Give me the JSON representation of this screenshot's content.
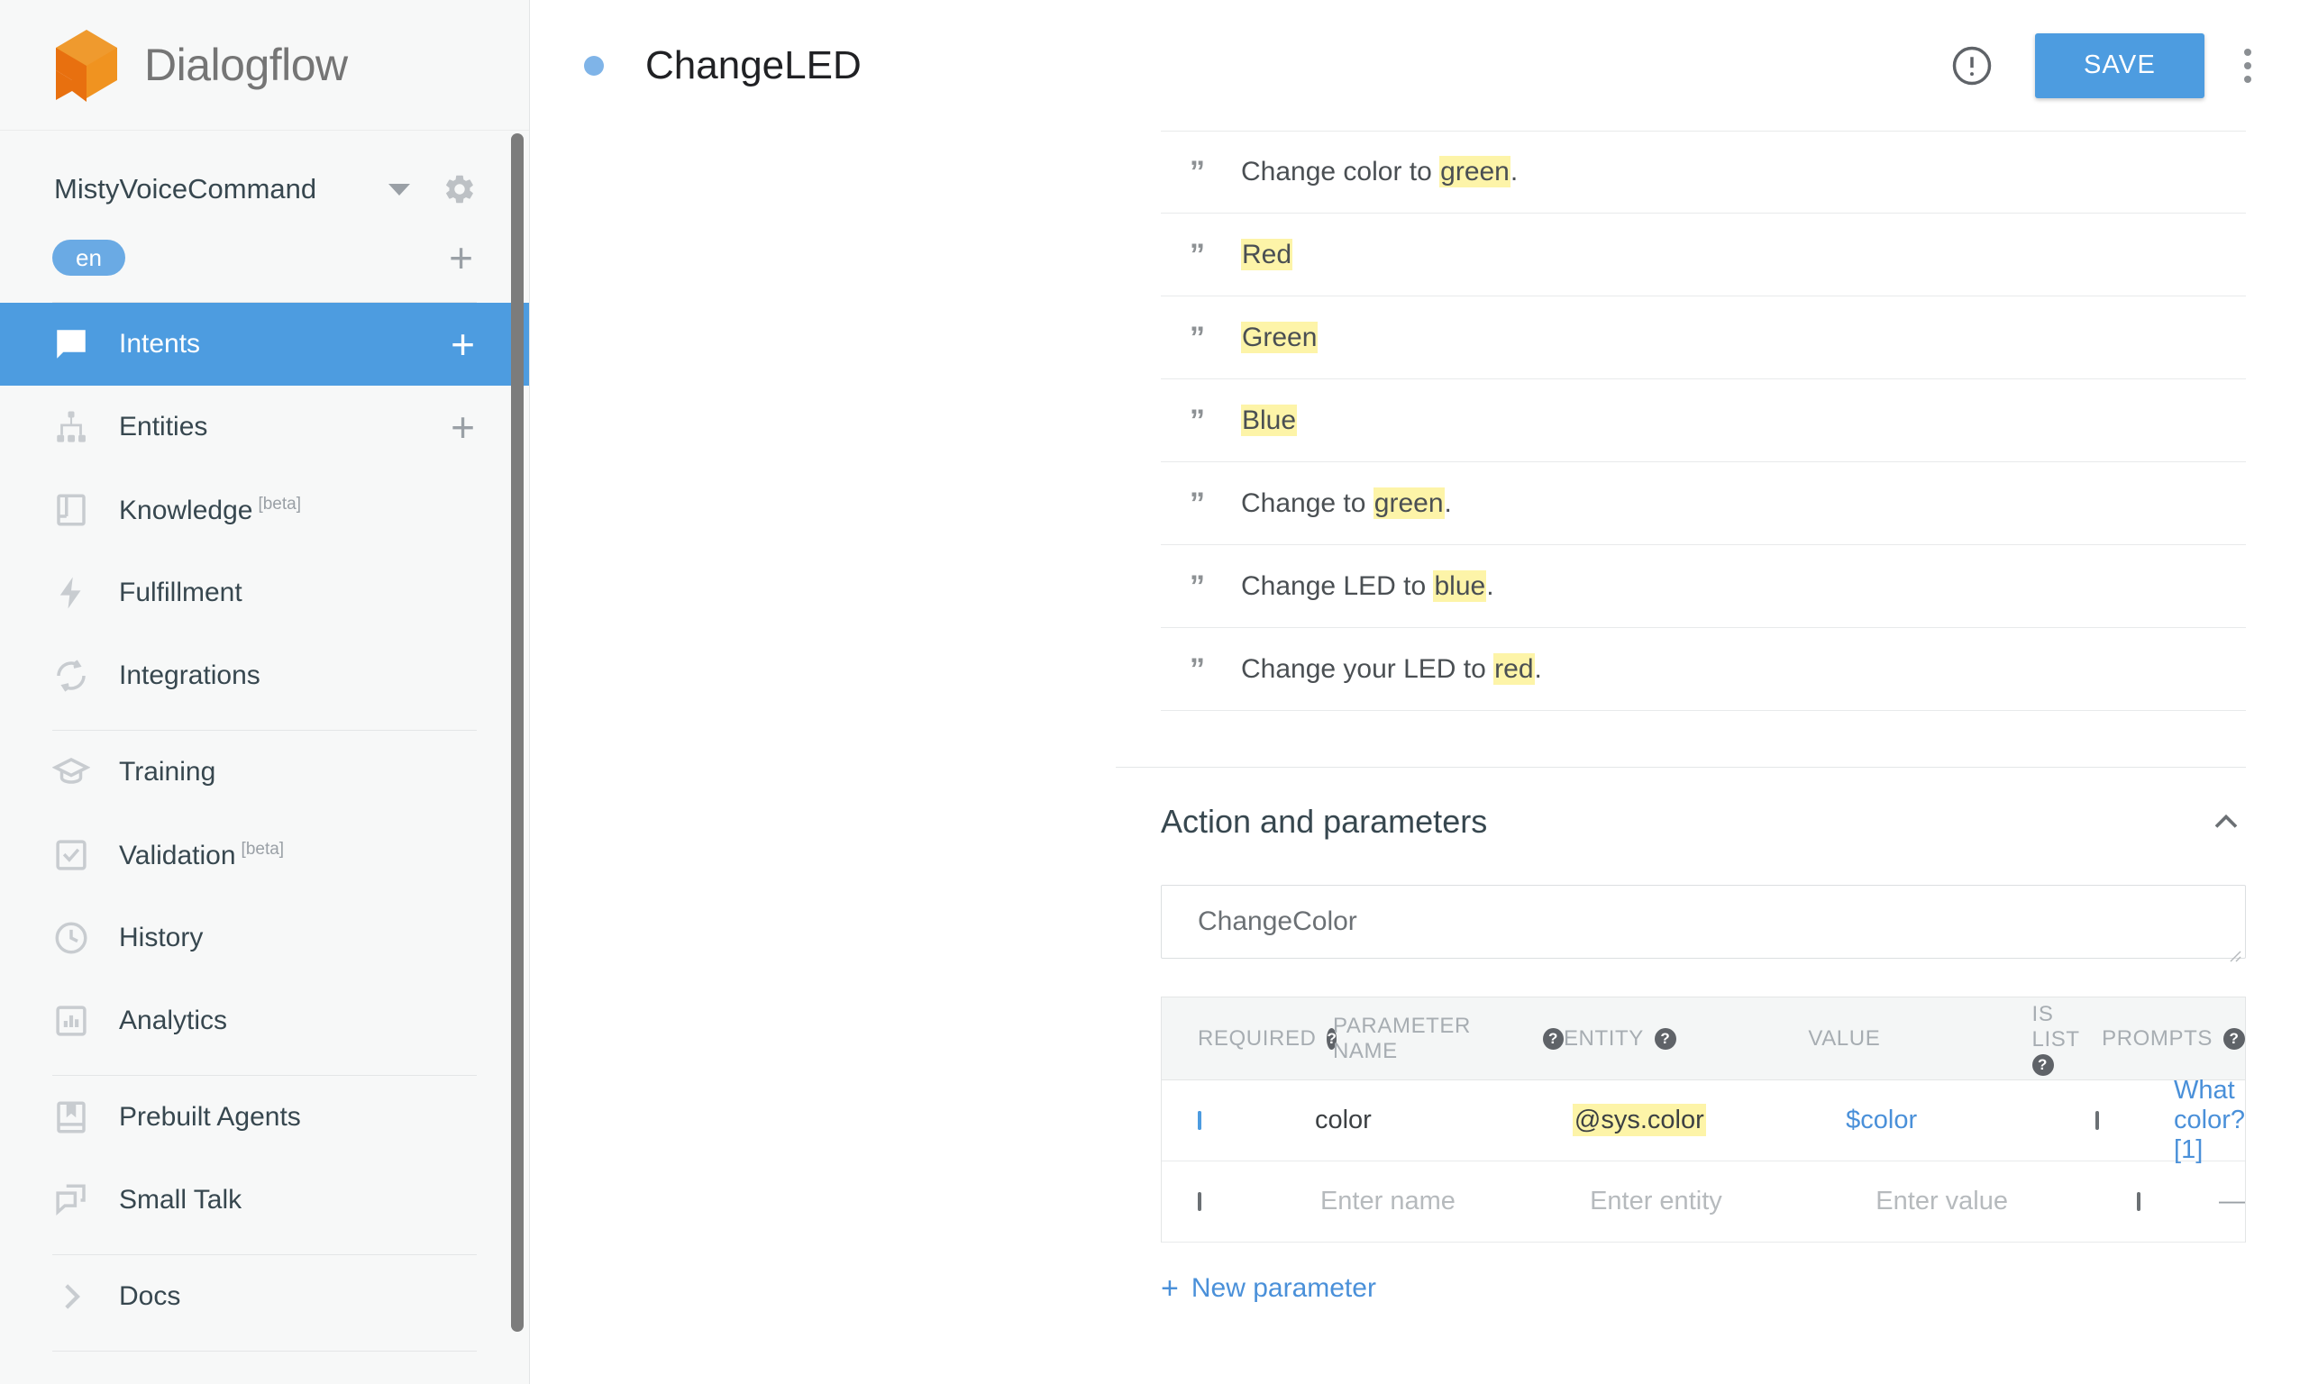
{
  "brand": {
    "name": "Dialogflow",
    "logo_icon": "dialogflow-cube-logo"
  },
  "sidebar": {
    "agent": {
      "name": "MistyVoiceCommand",
      "dropdown_icon": "chevron-down-icon",
      "settings_icon": "gear-icon"
    },
    "language": {
      "chip": "en",
      "add_icon": "plus-icon"
    },
    "items": [
      {
        "label": "Intents",
        "icon": "chat-bubble-icon",
        "active": true,
        "has_add": true,
        "beta": ""
      },
      {
        "label": "Entities",
        "icon": "hierarchy-icon",
        "active": false,
        "has_add": true,
        "beta": ""
      },
      {
        "label": "Knowledge",
        "icon": "book-icon",
        "active": false,
        "has_add": false,
        "beta": "[beta]"
      },
      {
        "label": "Fulfillment",
        "icon": "lightning-bolt-icon",
        "active": false,
        "has_add": false,
        "beta": ""
      },
      {
        "label": "Integrations",
        "icon": "sync-arrows-icon",
        "active": false,
        "has_add": false,
        "beta": ""
      },
      {
        "label": "Training",
        "icon": "graduation-cap-icon",
        "active": false,
        "has_add": false,
        "beta": ""
      },
      {
        "label": "Validation",
        "icon": "checkbox-square-icon",
        "active": false,
        "has_add": false,
        "beta": "[beta]"
      },
      {
        "label": "History",
        "icon": "clock-icon",
        "active": false,
        "has_add": false,
        "beta": ""
      },
      {
        "label": "Analytics",
        "icon": "bar-chart-icon",
        "active": false,
        "has_add": false,
        "beta": ""
      },
      {
        "label": "Prebuilt Agents",
        "icon": "bookmark-book-icon",
        "active": false,
        "has_add": false,
        "beta": ""
      },
      {
        "label": "Small Talk",
        "icon": "double-chat-icon",
        "active": false,
        "has_add": false,
        "beta": ""
      },
      {
        "label": "Docs",
        "icon": "chevron-right-icon",
        "active": false,
        "has_add": false,
        "beta": ""
      }
    ]
  },
  "topbar": {
    "status_dot_color": "#7fb4e8",
    "title": "ChangeLED",
    "warning_icon": "exclamation-circle-icon",
    "save_label": "SAVE",
    "more_icon": "kebab-menu-icon"
  },
  "training_phrases": [
    {
      "prefix": "Change color to ",
      "highlight": "green",
      "suffix": "."
    },
    {
      "prefix": "",
      "highlight": "Red",
      "suffix": ""
    },
    {
      "prefix": "",
      "highlight": "Green",
      "suffix": ""
    },
    {
      "prefix": "",
      "highlight": "Blue",
      "suffix": ""
    },
    {
      "prefix": "Change to ",
      "highlight": "green",
      "suffix": "."
    },
    {
      "prefix": "Change LED to ",
      "highlight": "blue",
      "suffix": "."
    },
    {
      "prefix": "Change your LED to ",
      "highlight": "red",
      "suffix": "."
    }
  ],
  "action_section": {
    "title": "Action and parameters",
    "collapse_icon": "chevron-up-icon",
    "action_value": "ChangeColor",
    "columns": [
      {
        "label": "REQUIRED",
        "help": true
      },
      {
        "label": "PARAMETER NAME",
        "help": true
      },
      {
        "label": "ENTITY",
        "help": true
      },
      {
        "label": "VALUE",
        "help": false
      },
      {
        "label": "IS LIST",
        "help": true
      },
      {
        "label": "PROMPTS",
        "help": true
      }
    ],
    "rows": [
      {
        "required": true,
        "name": "color",
        "name_placeholder": "",
        "entity": "@sys.color",
        "entity_placeholder": "",
        "value": "$color",
        "value_placeholder": "",
        "is_list": false,
        "prompts": "What color? [1]"
      },
      {
        "required": false,
        "name": "",
        "name_placeholder": "Enter name",
        "entity": "",
        "entity_placeholder": "Enter entity",
        "value": "",
        "value_placeholder": "Enter value",
        "is_list": false,
        "prompts": "—"
      }
    ],
    "new_parameter_label": "New parameter",
    "new_parameter_icon": "plus-icon"
  },
  "colors": {
    "accent_blue": "#4d9ce0",
    "highlight_yellow": "#fdf4a8",
    "link_blue": "#4a90d9",
    "logo_orange": "#e8700f"
  }
}
